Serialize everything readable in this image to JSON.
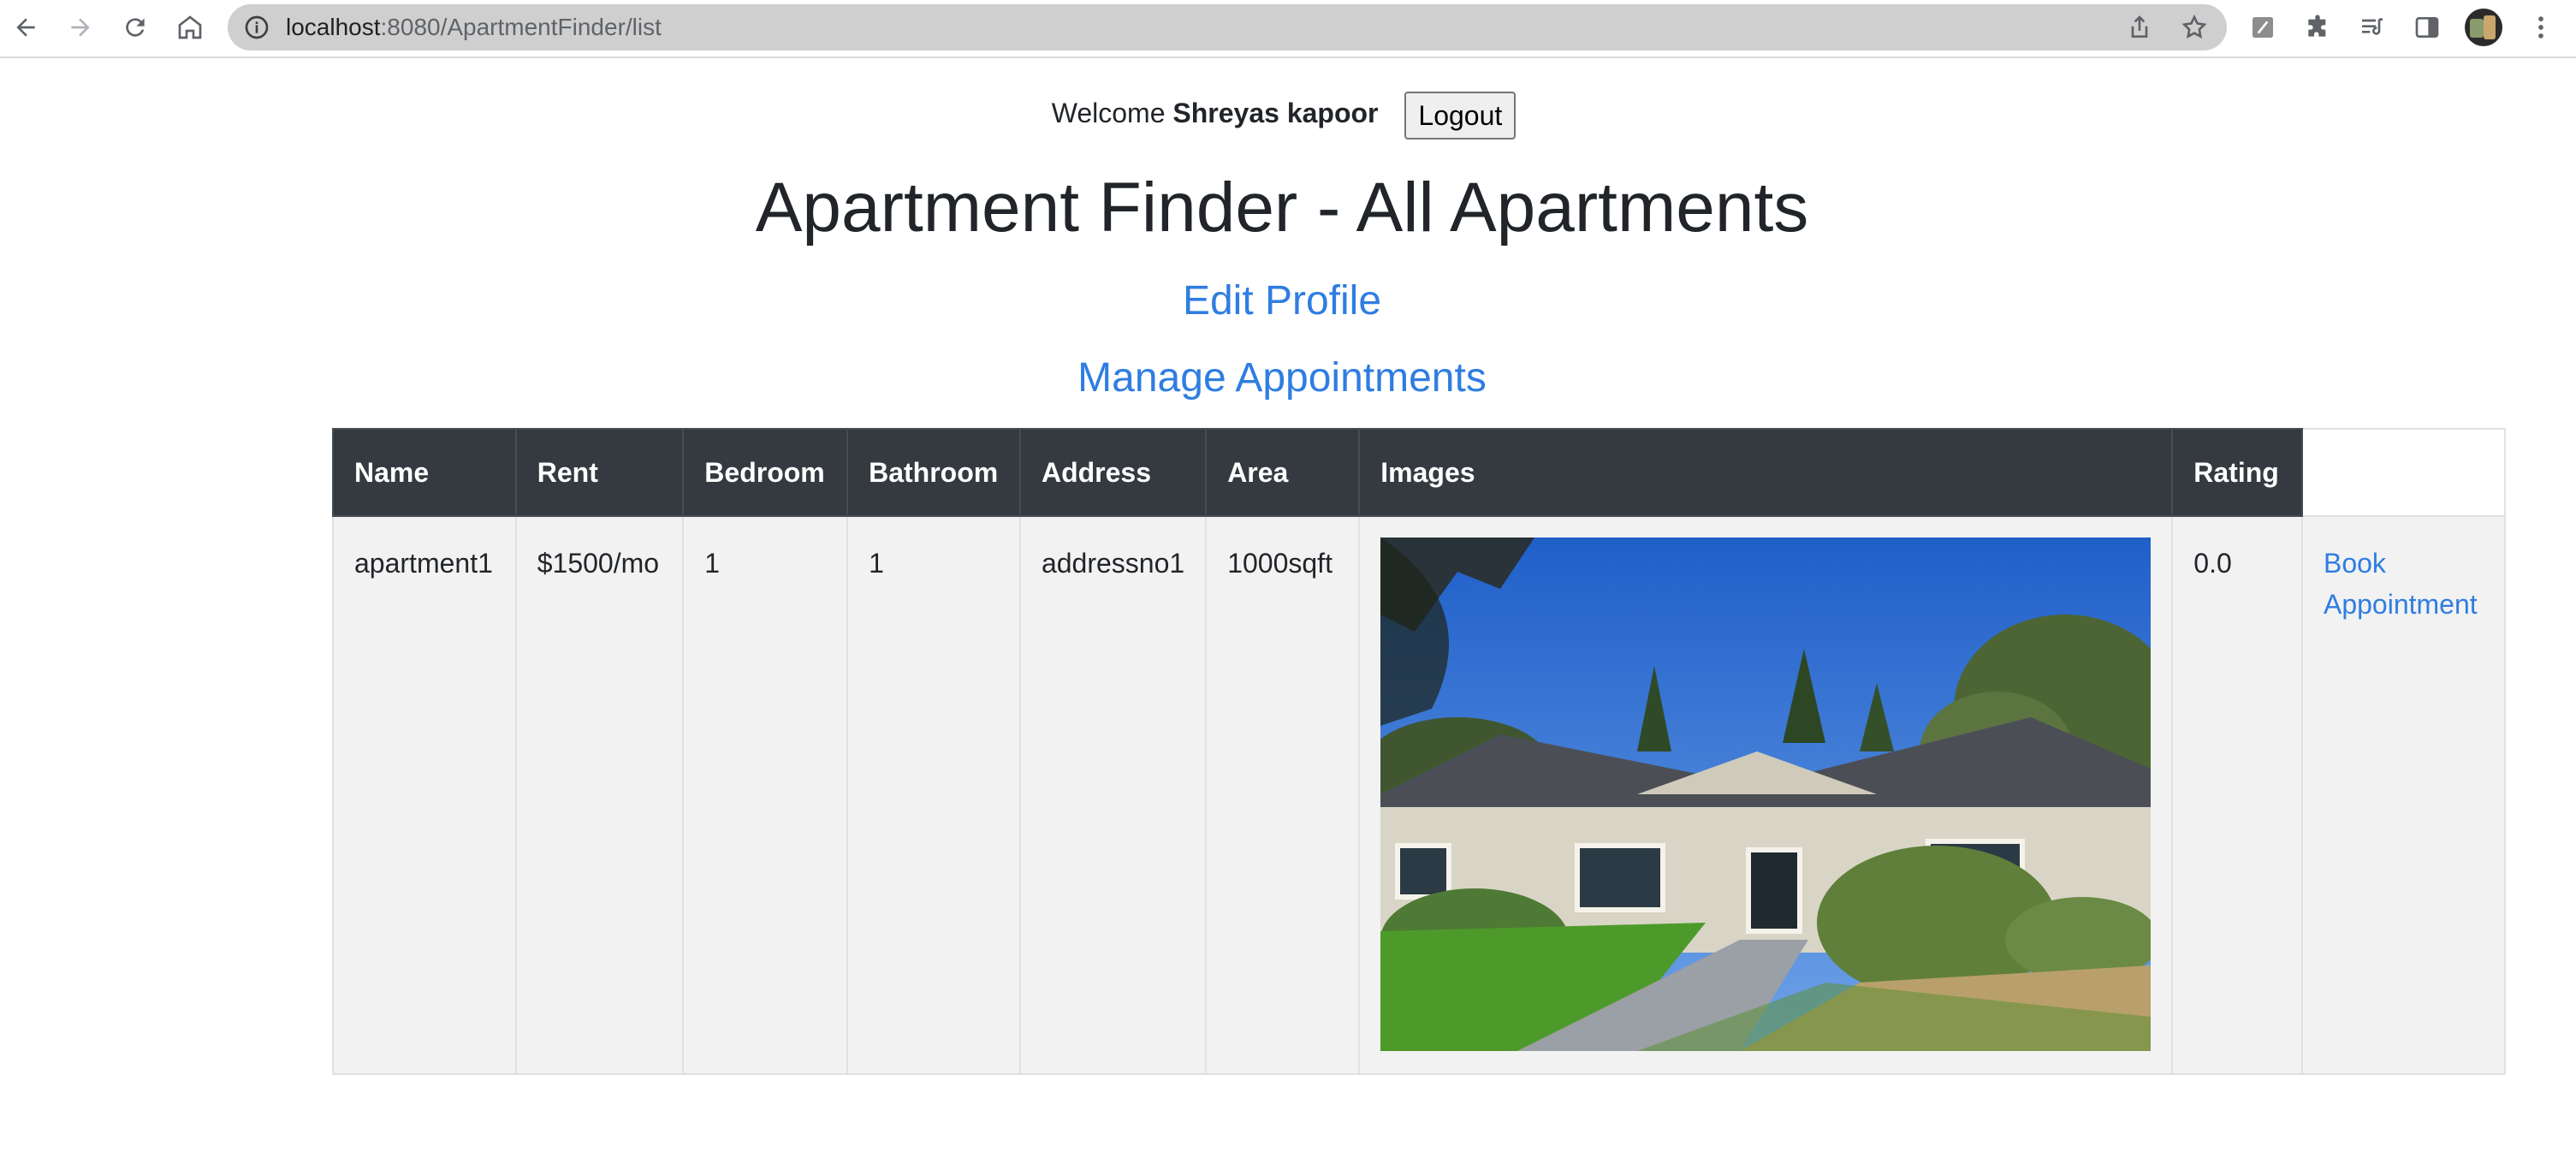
{
  "browser": {
    "url_host": "localhost",
    "url_path": ":8080/ApartmentFinder/list"
  },
  "header": {
    "welcome_prefix": "Welcome",
    "user_name": "Shreyas kapoor",
    "logout_label": "Logout"
  },
  "page": {
    "title": "Apartment Finder - All Apartments",
    "edit_profile_label": "Edit Profile",
    "manage_appointments_label": "Manage Appointments"
  },
  "table": {
    "headers": [
      "Name",
      "Rent",
      "Bedroom",
      "Bathroom",
      "Address",
      "Area",
      "Images",
      "Rating",
      ""
    ],
    "rows": [
      {
        "name": "apartment1",
        "rent": "$1500/mo",
        "bedroom": "1",
        "bathroom": "1",
        "address": "addressno1",
        "area": "1000sqft",
        "image": "house-exterior-photo",
        "rating": "0.0",
        "action_label": "Book Appointment"
      }
    ]
  },
  "colors": {
    "link": "#2f7de1",
    "table_header_bg": "#343a40",
    "row_bg": "#f2f2f2"
  }
}
